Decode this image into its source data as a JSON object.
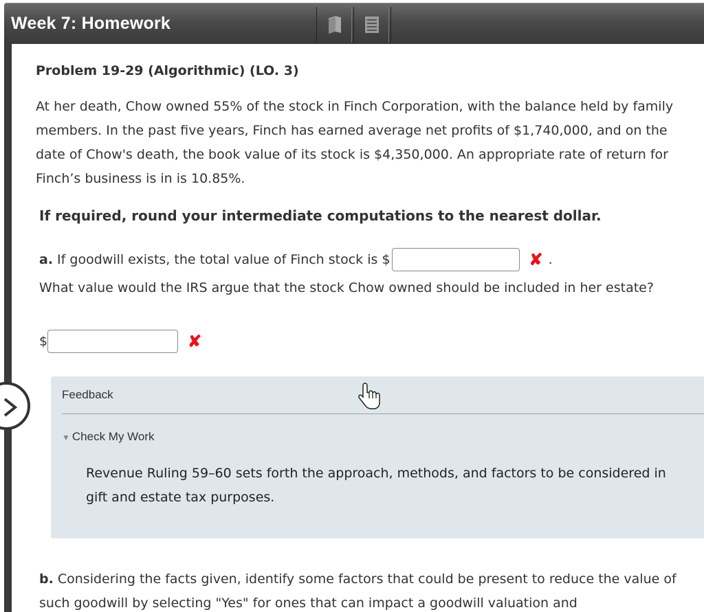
{
  "header": {
    "title": "Week 7: Homework",
    "buttons": [
      {
        "icon": "book-icon"
      },
      {
        "icon": "notes-icon"
      }
    ]
  },
  "problem": {
    "title": "Problem 19-29 (Algorithmic) (LO. 3)",
    "text": "At her death, Chow owned 55% of the stock in Finch Corporation, with the balance held by family members. In the past five years, Finch has earned average net profits of $1,740,000, and on the date of Chow's death, the book value of its stock is $4,350,000. An appropriate rate of return for Finch’s business is in is 10.85%.",
    "instruction": "If required, round your intermediate computations to the nearest dollar."
  },
  "part_a": {
    "label": "a.",
    "prompt": "If goodwill exists, the total value of Finch stock is $",
    "input1_value": "",
    "status1": "✘",
    "trailing": ".",
    "question2": "What value would the IRS argue that the stock Chow owned should be included in her estate?",
    "dollar": "$",
    "input2_value": "",
    "status2": "✘"
  },
  "feedback": {
    "label": "Feedback",
    "toggle_label": "Check My Work",
    "text_line1": "Revenue Ruling 59–60 sets forth the approach, methods, and factors to be considered in",
    "text_line2": "gift and estate tax purposes."
  },
  "part_b": {
    "label": "b.",
    "text": "Considering the facts given, identify some factors that could be present to reduce the value of such goodwill by selecting \"Yes\" for ones that can impact a goodwill valuation and"
  },
  "colors": {
    "header": "#4a4a4a",
    "error": "#e8141a",
    "feedback_bg": "#dfe7ec"
  }
}
